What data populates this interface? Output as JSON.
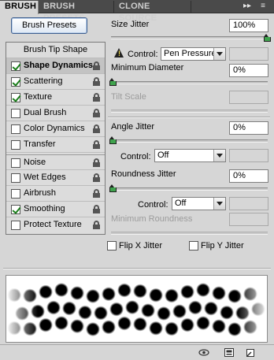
{
  "tabs": [
    {
      "label": "BRUSH",
      "active": true
    },
    {
      "label": "BRUSH PRESETS",
      "active": false
    },
    {
      "label": "CLONE SOURCE",
      "active": false
    }
  ],
  "tab_controls": {
    "expand": "▸▸",
    "menu": "≡"
  },
  "presets_button": "Brush Presets",
  "options": [
    {
      "label": "Brush Tip Shape",
      "header": true
    },
    {
      "label": "Shape Dynamics",
      "checked": true,
      "selected": true,
      "lock": true
    },
    {
      "label": "Scattering",
      "checked": true,
      "lock": true
    },
    {
      "label": "Texture",
      "checked": true,
      "lock": true
    },
    {
      "label": "Dual Brush",
      "checked": false,
      "lock": true
    },
    {
      "label": "Color Dynamics",
      "checked": false,
      "lock": true
    },
    {
      "label": "Transfer",
      "checked": false,
      "lock": true
    },
    {
      "label": "Noise",
      "checked": false,
      "lock": true
    },
    {
      "label": "Wet Edges",
      "checked": false,
      "lock": true
    },
    {
      "label": "Airbrush",
      "checked": false,
      "lock": true
    },
    {
      "label": "Smoothing",
      "checked": true,
      "lock": true
    },
    {
      "label": "Protect Texture",
      "checked": false,
      "lock": true
    }
  ],
  "size_jitter": {
    "label": "Size Jitter",
    "value": "100%",
    "level": 1.0
  },
  "control1": {
    "label": "Control:",
    "value": "Pen Pressure"
  },
  "min_diameter": {
    "label": "Minimum Diameter",
    "value": "0%",
    "level": 0.0
  },
  "tilt_scale": {
    "label": "Tilt Scale",
    "value": ""
  },
  "angle_jitter": {
    "label": "Angle Jitter",
    "value": "0%",
    "level": 0.0
  },
  "control2": {
    "label": "Control:",
    "value": "Off"
  },
  "roundness_jitter": {
    "label": "Roundness Jitter",
    "value": "0%",
    "level": 0.0
  },
  "control3": {
    "label": "Control:",
    "value": "Off"
  },
  "min_roundness": {
    "label": "Minimum Roundness",
    "value": ""
  },
  "flip_x": {
    "label": "Flip X Jitter",
    "checked": false
  },
  "flip_y": {
    "label": "Flip Y Jitter",
    "checked": false
  },
  "colors": {
    "active_tab_bg": "#d6d6d6",
    "tab_bar_bg": "#4a4a4a",
    "slider_thumb": "#3fa34d",
    "check_mark": "#1a7d1a"
  }
}
